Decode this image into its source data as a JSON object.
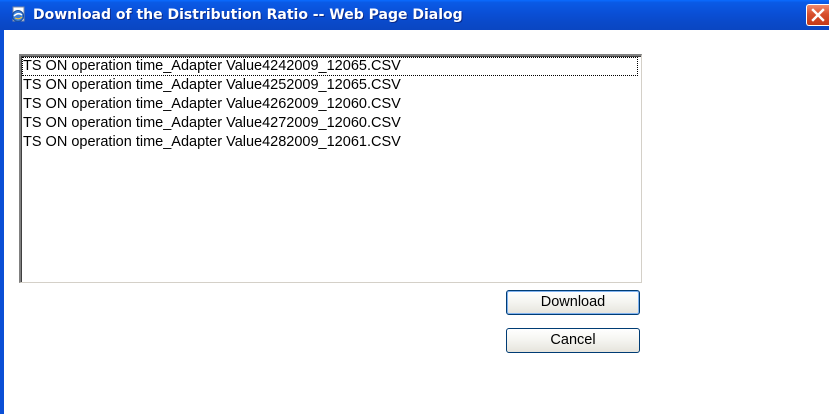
{
  "window": {
    "title": "Download of the Distribution Ratio -- Web Page Dialog",
    "icon": "ie-page-icon",
    "close_icon": "close-icon"
  },
  "file_list": {
    "items": [
      {
        "label": "TS ON operation time_Adapter Value4242009_12065.CSV",
        "focused": true
      },
      {
        "label": "TS ON operation time_Adapter Value4252009_12065.CSV",
        "focused": false
      },
      {
        "label": "TS ON operation time_Adapter Value4262009_12060.CSV",
        "focused": false
      },
      {
        "label": "TS ON operation time_Adapter Value4272009_12060.CSV",
        "focused": false
      },
      {
        "label": "TS ON operation time_Adapter Value4282009_12061.CSV",
        "focused": false
      }
    ]
  },
  "buttons": {
    "download_label": "Download",
    "cancel_label": "Cancel"
  },
  "colors": {
    "titlebar": "#0a4fd6",
    "close_button": "#d8502e",
    "button_border": "#003c74"
  }
}
